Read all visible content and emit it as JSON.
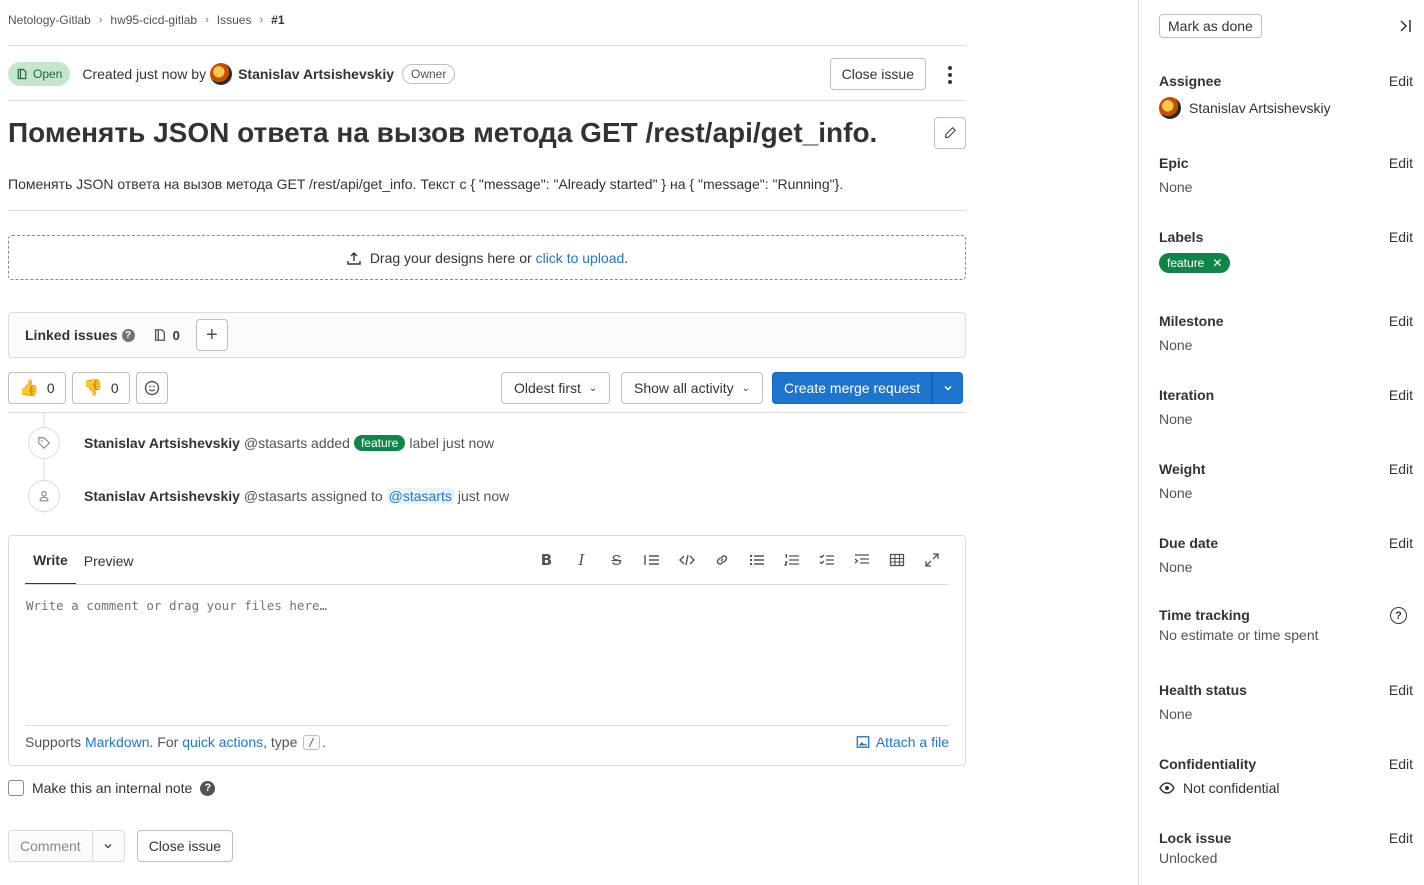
{
  "breadcrumb": {
    "items": [
      "Netology-Gitlab",
      "hw95-cicd-gitlab",
      "Issues"
    ],
    "current": "#1"
  },
  "issue": {
    "status": "Open",
    "created_text": "Created just now by",
    "author": "Stanislav Artsishevskiy",
    "role_badge": "Owner",
    "close_label": "Close issue",
    "title": "Поменять JSON ответа на вызов метода GET /rest/api/get_info.",
    "description": "Поменять JSON ответа на вызов метода GET /rest/api/get_info. Текст с { \"message\": \"Already started\" } на { \"message\": \"Running\"}."
  },
  "dropzone": {
    "text": "Drag your designs here or",
    "link": "click to upload",
    "suffix": "."
  },
  "linked_issues": {
    "title": "Linked issues",
    "count": "0"
  },
  "reactions": {
    "thumbs_up": "0",
    "thumbs_down": "0"
  },
  "sorting": {
    "order_label": "Oldest first",
    "filter_label": "Show all activity"
  },
  "merge": {
    "label": "Create merge request"
  },
  "activity": [
    {
      "author": "Stanislav Artsishevskiy",
      "handle": "@stasarts",
      "action_pre": "added",
      "label": "feature",
      "action_post": "label just now"
    },
    {
      "author": "Stanislav Artsishevskiy",
      "handle": "@stasarts",
      "action_pre": "assigned to",
      "mention": "@stasarts",
      "action_post": "just now"
    }
  ],
  "comment": {
    "tab_write": "Write",
    "tab_preview": "Preview",
    "placeholder": "Write a comment or drag your files here…",
    "supports": "Supports",
    "markdown": "Markdown",
    "for_text": ". For",
    "quick_actions": "quick actions",
    "type_text": ", type",
    "slash": "/",
    "period": ".",
    "attach": "Attach a file",
    "internal_note": "Make this an internal note",
    "comment_button": "Comment",
    "close_button": "Close issue"
  },
  "sidebar": {
    "mark_done": "Mark as done",
    "edit_label": "Edit",
    "assignee": {
      "title": "Assignee",
      "value": "Stanislav Artsishevskiy"
    },
    "epic": {
      "title": "Epic",
      "value": "None"
    },
    "labels": {
      "title": "Labels",
      "value": "feature"
    },
    "milestone": {
      "title": "Milestone",
      "value": "None"
    },
    "iteration": {
      "title": "Iteration",
      "value": "None"
    },
    "weight": {
      "title": "Weight",
      "value": "None"
    },
    "due_date": {
      "title": "Due date",
      "value": "None"
    },
    "time_tracking": {
      "title": "Time tracking",
      "value": "No estimate or time spent"
    },
    "health_status": {
      "title": "Health status",
      "value": "None"
    },
    "confidentiality": {
      "title": "Confidentiality",
      "value": "Not confidential"
    },
    "lock_issue": {
      "title": "Lock issue",
      "value": "Unlocked"
    }
  },
  "colors": {
    "primary": "#1f75cb",
    "success": "#108548",
    "status_open_bg": "#c3e6cd"
  }
}
